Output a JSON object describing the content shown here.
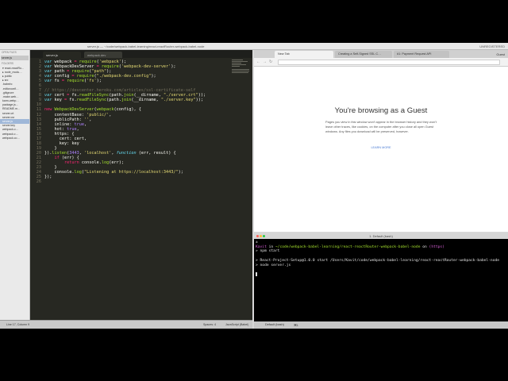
{
  "menubar": {
    "title": "server.js — ~/code/webpack-babel-learning/react-reactRouter-webpack-babel-node",
    "right": "UNREGISTERED"
  },
  "editor": {
    "sidebar": {
      "open_files_title": "OPEN FILES",
      "open_file": "server.js",
      "folders_title": "FOLDERS",
      "files": [
        "▾ react-reactRo…",
        "▸ node_modu…",
        "▸ public",
        "▸ src",
        ".babelrc",
        ".editorconfi…",
        ".gitignore",
        ".make-web…",
        "karm-webp…",
        "package.js…",
        "README.m…",
        "server.crt",
        "server.csr",
        "server.js",
        "server.key",
        "webpack-c…",
        "webpack.c…",
        "webpack.co…"
      ],
      "selected_index": 13
    },
    "tabs": [
      {
        "label": "server.js"
      },
      {
        "label": "webpack.dev"
      }
    ],
    "line_numbers": [
      "1",
      "2",
      "3",
      "4",
      "5",
      "6",
      "7",
      "8",
      "9",
      "10",
      "11",
      "12",
      "13",
      "14",
      "15",
      "16",
      "17",
      "18",
      "19",
      "20",
      "21",
      "22",
      "23",
      "24",
      "25",
      "26"
    ],
    "status": {
      "position": "Line 17, Column 9",
      "spaces": "Spaces: 4",
      "syntax": "JavaScript (Babel)"
    }
  },
  "browser": {
    "tabs": [
      {
        "label": "New Tab"
      },
      {
        "label": "Creating a Self-Signed SSL C…"
      },
      {
        "label": "#1: Payment Request API"
      }
    ],
    "profile": "Guest",
    "nav_back": "←",
    "nav_forward": "→",
    "nav_reload": "↻",
    "title": "You're browsing as a Guest",
    "body": "Pages you view in this window won't appear in the browser history and they won't leave other traces, like cookies, on the computer after you close all open Guest windows. Any files you download will be preserved, however.",
    "link": "LEARN MORE"
  },
  "terminal": {
    "title": "1. Default (bash)",
    "lines": {
      "l0": "±",
      "user": "Kavit",
      "in": " in ",
      "path": "~/code/webpack-babel-learning/react-reactRouter-webpack-babel-node",
      "on": " on ",
      "branch": "(https)",
      "cmd1": "» npm start",
      "blank1": " ",
      "out1": "> React-Project-Setup@1.0.0 start /Users/Kavit/code/webpack-babel-learning/react-reactRouter-webpack-babel-node",
      "out2": "> node server.js",
      "blank2": " "
    },
    "tabs": [
      "Default (bash)",
      "⌘1"
    ]
  },
  "colors": {
    "editor_bg": "#272822",
    "keyword": "#66d9ef",
    "string": "#e6db74",
    "function": "#a6e22e",
    "comment": "#75715e"
  }
}
